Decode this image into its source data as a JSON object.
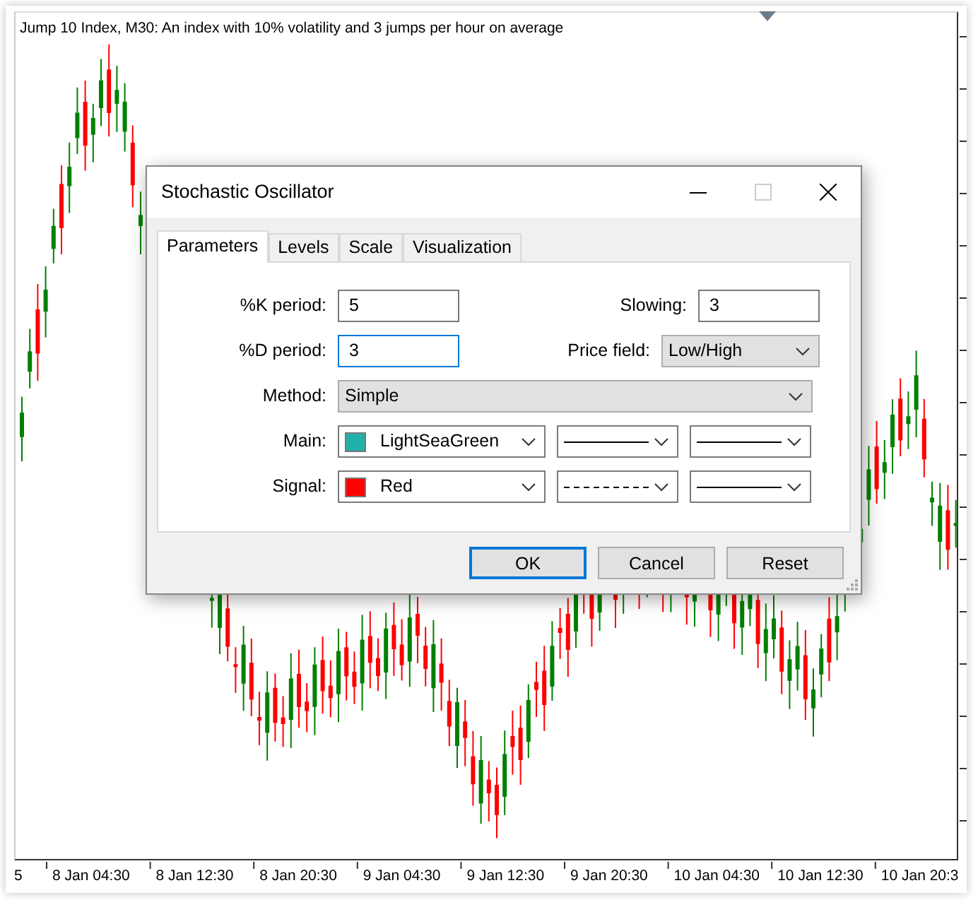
{
  "chart": {
    "title": "Jump 10 Index, M30:  An index with 10% volatility and 3 jumps per hour on average",
    "x_labels": [
      "5",
      "8 Jan 04:30",
      "8 Jan 12:30",
      "8 Jan 20:30",
      "9 Jan 04:30",
      "9 Jan 12:30",
      "9 Jan 20:30",
      "10 Jan 04:30",
      "10 Jan 12:30",
      "10 Jan 20:3"
    ]
  },
  "dialog": {
    "title": "Stochastic Oscillator",
    "tabs": [
      {
        "label": "Parameters",
        "selected": true
      },
      {
        "label": "Levels",
        "selected": false
      },
      {
        "label": "Scale",
        "selected": false
      },
      {
        "label": "Visualization",
        "selected": false
      }
    ],
    "k_period": {
      "label": "%K period:",
      "value": "5",
      "focused": false
    },
    "slowing": {
      "label": "Slowing:",
      "value": "3",
      "focused": false
    },
    "d_period": {
      "label": "%D period:",
      "value": "3",
      "focused": true
    },
    "price_field": {
      "label": "Price field:",
      "value": "Low/High"
    },
    "method": {
      "label": "Method:",
      "value": "Simple"
    },
    "lines": [
      {
        "label": "Main:",
        "color_name": "LightSeaGreen",
        "color": "#20b2aa",
        "kind": "solid"
      },
      {
        "label": "Signal:",
        "color_name": "Red",
        "color": "#ff0000",
        "kind": "dashed"
      }
    ],
    "buttons": [
      {
        "label": "OK",
        "default": true
      },
      {
        "label": "Cancel",
        "default": false
      },
      {
        "label": "Reset",
        "default": false
      }
    ]
  }
}
